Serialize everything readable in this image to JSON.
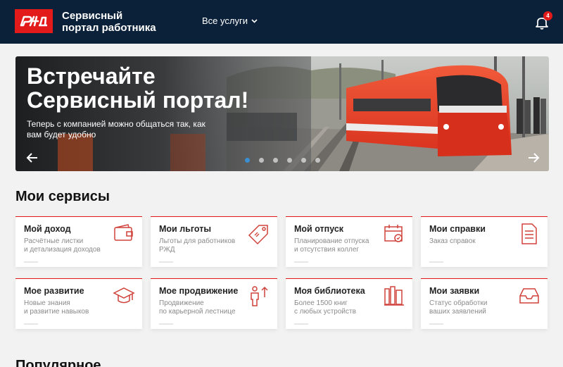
{
  "header": {
    "logo_text": "РЖД",
    "brand_line1": "Сервисный",
    "brand_line2": "портал работника",
    "menu_label": "Все услуги",
    "notification_count": "4"
  },
  "banner": {
    "title_line1": "Встречайте",
    "title_line2": "Сервисный портал!",
    "subtitle": "Теперь с компанией можно общаться так, как вам будет удобно",
    "active_slide": 1,
    "slide_count": 6
  },
  "services": {
    "title": "Мои сервисы",
    "items": [
      {
        "title": "Мой доход",
        "desc": "Расчётные листки\nи детализация доходов",
        "icon": "wallet-icon"
      },
      {
        "title": "Мои льготы",
        "desc": "Льготы для работников\nРЖД",
        "icon": "tag-icon"
      },
      {
        "title": "Мой отпуск",
        "desc": "Планирование отпуска\nи отсутствия коллег",
        "icon": "calendar-icon"
      },
      {
        "title": "Мои справки",
        "desc": "Заказ справок",
        "icon": "document-icon"
      },
      {
        "title": "Мое развитие",
        "desc": "Новые знания\nи развитие навыков",
        "icon": "graduation-cap-icon"
      },
      {
        "title": "Мое продвижение",
        "desc": "Продвижение\nпо карьерной лестнице",
        "icon": "career-icon"
      },
      {
        "title": "Моя библиотека",
        "desc": "Более 1500 книг\nс любых устройств",
        "icon": "books-icon"
      },
      {
        "title": "Мои заявки",
        "desc": "Статус обработки\nваших заявлений",
        "icon": "inbox-icon"
      }
    ]
  },
  "popular": {
    "title": "Популярное"
  },
  "colors": {
    "header_bg": "#0b2139",
    "accent": "#e21a1a",
    "background": "#f2f2f2"
  }
}
